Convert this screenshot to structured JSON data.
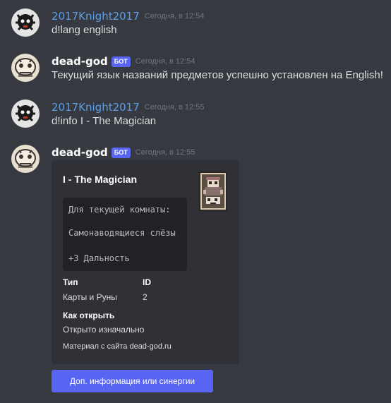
{
  "messages": [
    {
      "author": "2017Knight2017",
      "timestamp": "Сегодня, в 12:54",
      "text": "d!lang english"
    },
    {
      "author": "dead-god",
      "badge": "БОТ",
      "timestamp": "Сегодня, в 12:54",
      "text": "Текущий язык названий предметов успешно установлен на English!"
    },
    {
      "author": "2017Knight2017",
      "timestamp": "Сегодня, в 12:55",
      "text": "d!info I - The Magician"
    },
    {
      "author": "dead-god",
      "badge": "БОТ",
      "timestamp": "Сегодня, в 12:55"
    }
  ],
  "embed": {
    "title": "I - The Magician",
    "code_lines": [
      "Для текущей комнаты:",
      "Самонаводящиеся слёзы",
      "+3 Дальность"
    ],
    "fields": [
      {
        "name": "Тип",
        "value": "Карты и Руны"
      },
      {
        "name": "ID",
        "value": "2"
      },
      {
        "name": "Как открыть",
        "value": "Открыто изначально"
      }
    ],
    "footer": "Материал с сайта dead-god.ru"
  },
  "button": {
    "label": "Доп. информация или синергии"
  },
  "colors": {
    "background": "#36393f",
    "embed_bg": "#2f3136",
    "code_bg": "#202225",
    "accent": "#5865f2",
    "human_name": "#5b9ee8"
  }
}
